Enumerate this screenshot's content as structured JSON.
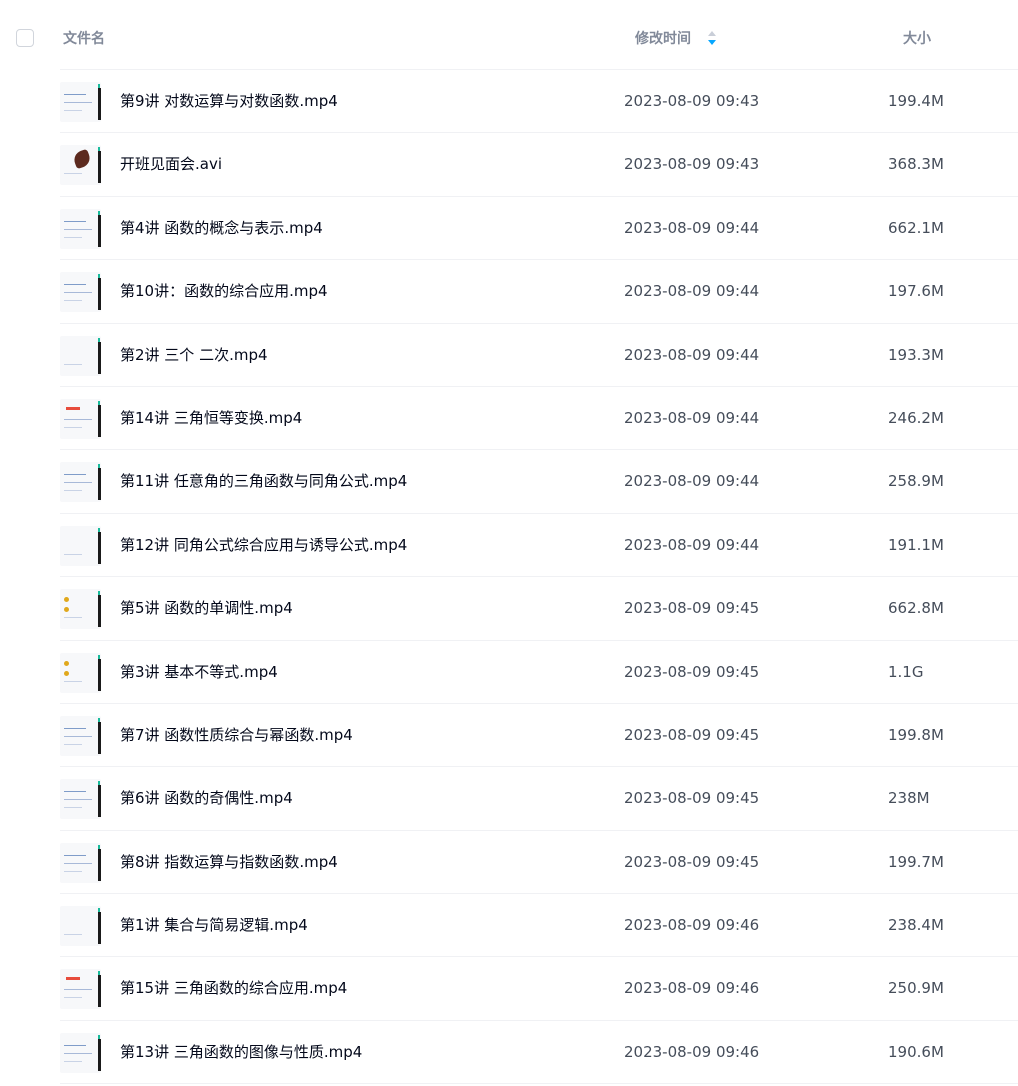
{
  "header": {
    "name_label": "文件名",
    "time_label": "修改时间",
    "size_label": "大小",
    "sort_icon": "sort-descending-icon",
    "accent_color": "#06a7ff"
  },
  "files": [
    {
      "name": "第9讲 对数运算与对数函数.mp4",
      "time": "2023-08-09 09:43",
      "size": "199.4M"
    },
    {
      "name": "开班见面会.avi",
      "time": "2023-08-09 09:43",
      "size": "368.3M"
    },
    {
      "name": "第4讲 函数的概念与表示.mp4",
      "time": "2023-08-09 09:44",
      "size": "662.1M"
    },
    {
      "name": "第10讲：函数的综合应用.mp4",
      "time": "2023-08-09 09:44",
      "size": "197.6M"
    },
    {
      "name": "第2讲 三个 二次.mp4",
      "time": "2023-08-09 09:44",
      "size": "193.3M"
    },
    {
      "name": "第14讲 三角恒等变换.mp4",
      "time": "2023-08-09 09:44",
      "size": "246.2M"
    },
    {
      "name": "第11讲 任意角的三角函数与同角公式.mp4",
      "time": "2023-08-09 09:44",
      "size": "258.9M"
    },
    {
      "name": "第12讲 同角公式综合应用与诱导公式.mp4",
      "time": "2023-08-09 09:44",
      "size": "191.1M"
    },
    {
      "name": "第5讲 函数的单调性.mp4",
      "time": "2023-08-09 09:45",
      "size": "662.8M"
    },
    {
      "name": "第3讲 基本不等式.mp4",
      "time": "2023-08-09 09:45",
      "size": "1.1G"
    },
    {
      "name": "第7讲 函数性质综合与幂函数.mp4",
      "time": "2023-08-09 09:45",
      "size": "199.8M"
    },
    {
      "name": "第6讲 函数的奇偶性.mp4",
      "time": "2023-08-09 09:45",
      "size": "238M"
    },
    {
      "name": "第8讲 指数运算与指数函数.mp4",
      "time": "2023-08-09 09:45",
      "size": "199.7M"
    },
    {
      "name": "第1讲 集合与简易逻辑.mp4",
      "time": "2023-08-09 09:46",
      "size": "238.4M"
    },
    {
      "name": "第15讲 三角函数的综合应用.mp4",
      "time": "2023-08-09 09:46",
      "size": "250.9M"
    },
    {
      "name": "第13讲 三角函数的图像与性质.mp4",
      "time": "2023-08-09 09:46",
      "size": "190.6M"
    }
  ]
}
